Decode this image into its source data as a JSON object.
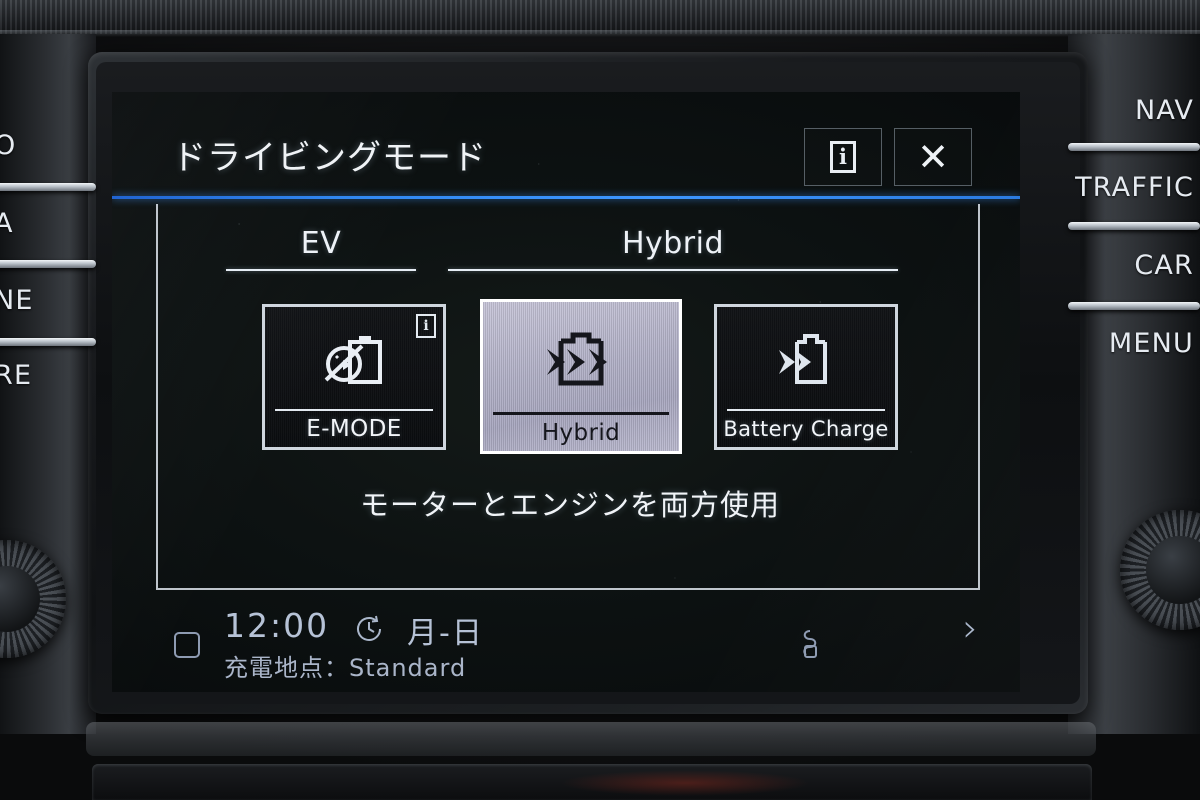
{
  "screen": {
    "header": {
      "title": "ドライビングモード",
      "info_button": "i",
      "close_button": "✕"
    },
    "columns": [
      {
        "label": "EV"
      },
      {
        "label": "Hybrid"
      }
    ],
    "modes": [
      {
        "id": "e-mode",
        "label": "E-MODE",
        "badge": "i",
        "selected": false,
        "icon": "battery-no-engine-icon"
      },
      {
        "id": "hybrid",
        "label": "Hybrid",
        "badge": "",
        "selected": true,
        "icon": "battery-bidirectional-flow-icon"
      },
      {
        "id": "battery-charge",
        "label": "Battery Charge",
        "badge": "",
        "selected": false,
        "icon": "battery-charge-arrows-icon"
      }
    ],
    "description": "モーターとエンジンを両方使用",
    "status_bar": {
      "time": "12:00",
      "date": "月-日",
      "charge_point_label": "充電地点：Standard",
      "next_chevron": "›"
    }
  },
  "bezel": {
    "right_keys": [
      "NAV",
      "TRAFFIC",
      "CAR",
      "MENU"
    ],
    "left_keys": [
      "O",
      "A",
      "NE",
      "RE"
    ]
  },
  "colors": {
    "accent_blue": "#3d96ff",
    "screen_text": "#f0f3f6",
    "selected_tile_bg": "#b3b2c8",
    "status_text": "#b6c2d6"
  }
}
